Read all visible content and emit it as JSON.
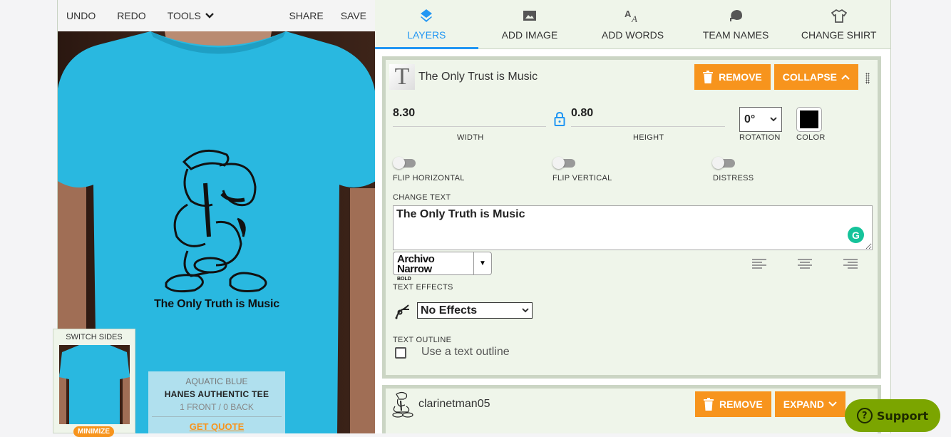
{
  "toolbar": {
    "undo": "UNDO",
    "redo": "REDO",
    "tools": "TOOLS",
    "share": "SHARE",
    "save": "SAVE"
  },
  "design": {
    "text": "The Only Truth is Music",
    "shirt_color_hex": "#29b8e0"
  },
  "switch_sides": {
    "label": "SWITCH SIDES",
    "minimize": "MINIMIZE"
  },
  "quote": {
    "color": "AQUATIC BLUE",
    "product": "HANES AUTHENTIC TEE",
    "count": "1 FRONT / 0 BACK",
    "get_quote": "GET QUOTE"
  },
  "tabs": [
    {
      "label": "LAYERS",
      "icon": "layers-icon",
      "active": true
    },
    {
      "label": "ADD IMAGE",
      "icon": "image-icon",
      "active": false
    },
    {
      "label": "ADD WORDS",
      "icon": "text-icon",
      "active": false
    },
    {
      "label": "TEAM NAMES",
      "icon": "helmet-icon",
      "active": false
    },
    {
      "label": "CHANGE SHIRT",
      "icon": "shirt-icon",
      "active": false
    }
  ],
  "layers": [
    {
      "name": "The Only Trust is Music",
      "remove": "REMOVE",
      "toggle": "COLLAPSE",
      "width": "8.30",
      "width_label": "WIDTH",
      "height": "0.80",
      "height_label": "HEIGHT",
      "rotation": "0°",
      "rotation_label": "ROTATION",
      "color_label": "COLOR",
      "color_hex": "#000000",
      "flip_horizontal": "FLIP HORIZONTAL",
      "flip_vertical": "FLIP VERTICAL",
      "distress": "DISTRESS",
      "change_text_label": "CHANGE TEXT",
      "text_value": "The Only Truth is Music",
      "font_name": "Archivo Narrow",
      "font_weight": "BOLD",
      "text_effects_label": "TEXT EFFECTS",
      "text_effect": "No Effects",
      "text_outline_label": "TEXT OUTLINE",
      "outline_checkbox": "Use a text outline"
    },
    {
      "name": "clarinetman05",
      "remove": "REMOVE",
      "toggle": "EXPAND"
    }
  ],
  "support": {
    "label": "Support"
  },
  "colors": {
    "accent": "#f7941d",
    "tab_active": "#2196f3",
    "support": "#7ba500"
  }
}
